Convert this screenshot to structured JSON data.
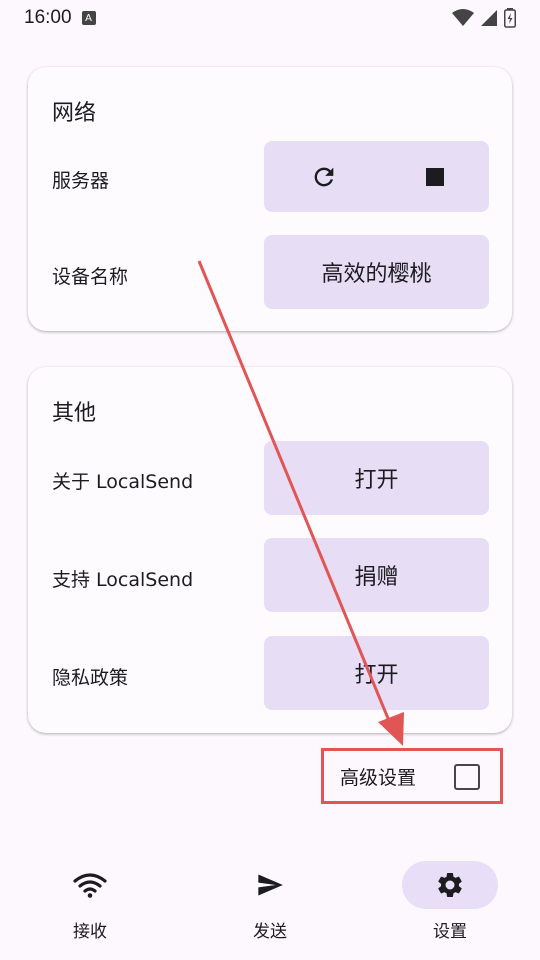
{
  "status_bar": {
    "time": "16:00",
    "notification_icon": "a-badge-icon"
  },
  "network_card": {
    "title": "网络",
    "server_label": "服务器",
    "server_icons": [
      "refresh-icon",
      "stop-icon"
    ],
    "device_name_label": "设备名称",
    "device_name_value": "高效的樱桃"
  },
  "other_card": {
    "title": "其他",
    "rows": [
      {
        "label": "关于 LocalSend",
        "button": "打开"
      },
      {
        "label": "支持 LocalSend",
        "button": "捐赠"
      },
      {
        "label": "隐私政策",
        "button": "打开"
      }
    ]
  },
  "advanced": {
    "label": "高级设置",
    "checked": false
  },
  "annotation": {
    "highlight_color": "#e25555"
  },
  "nav": {
    "items": [
      {
        "label": "接收",
        "icon": "wifi-icon",
        "active": false
      },
      {
        "label": "发送",
        "icon": "send-icon",
        "active": false
      },
      {
        "label": "设置",
        "icon": "gear-icon",
        "active": true
      }
    ]
  },
  "colors": {
    "background": "#fdf8fd",
    "button": "#e7def6",
    "nav_active": "#e8def8"
  }
}
